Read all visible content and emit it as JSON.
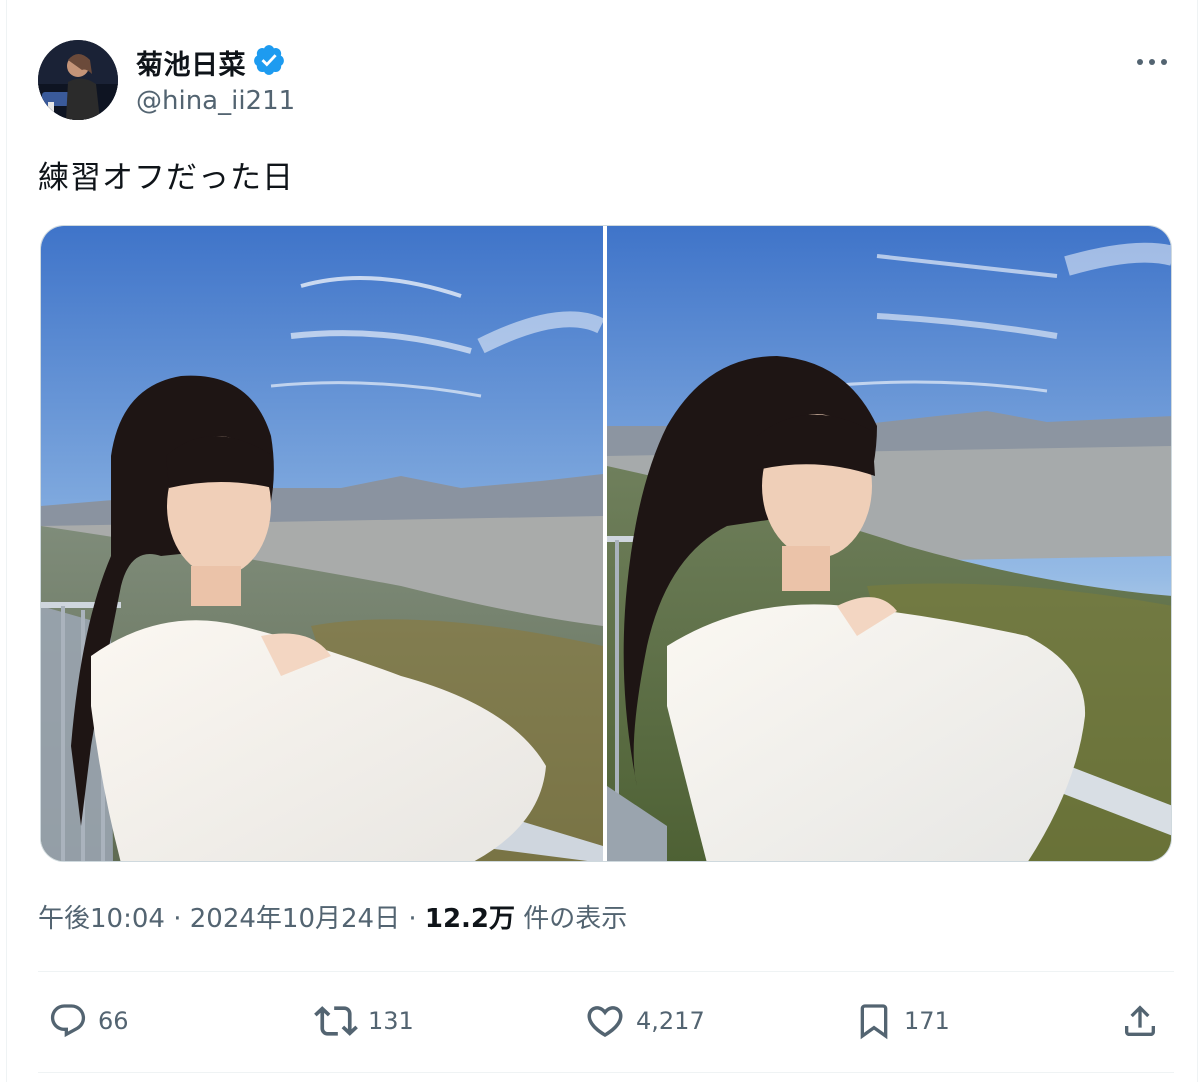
{
  "author": {
    "display_name": "菊池日菜",
    "handle": "@hina_ii211",
    "verified": true,
    "verified_color": "#1d9bf0"
  },
  "more_icon": "more-horizontal-icon",
  "tweet": {
    "text": "練習オフだった日"
  },
  "media": [
    {
      "alt": "left-photo"
    },
    {
      "alt": "right-photo"
    }
  ],
  "meta": {
    "time": "午後10:04",
    "separator": " · ",
    "date": "2024年10月24日",
    "views_count": "12.2万",
    "views_label": " 件の表示"
  },
  "actions": {
    "reply": {
      "icon": "reply-icon",
      "count": "66"
    },
    "repost": {
      "icon": "repost-icon",
      "count": "131"
    },
    "like": {
      "icon": "heart-icon",
      "count": "4,217"
    },
    "bookmark": {
      "icon": "bookmark-icon",
      "count": "171"
    },
    "share": {
      "icon": "share-icon"
    }
  },
  "colors": {
    "text_primary": "#0f1419",
    "text_secondary": "#536471",
    "border": "#cfd9de",
    "divider": "#eff3f4"
  }
}
